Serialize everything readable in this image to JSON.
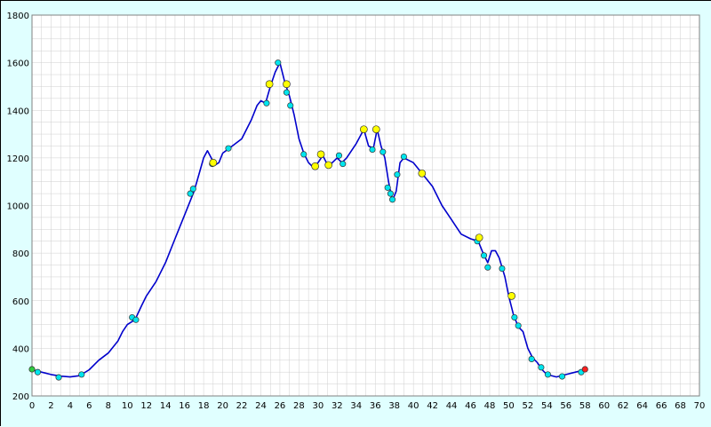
{
  "colors": {
    "page_background": "#e0ffff",
    "plot_background": "#ffffff",
    "grid": "#cfcfcf",
    "line": "#0000cc",
    "marker_cyan": "#00e5ee",
    "marker_yellow": "#ffff00",
    "marker_start": "#2ecc40",
    "marker_end": "#ff2020"
  },
  "chart_data": {
    "type": "line",
    "title": "",
    "xlabel": "",
    "ylabel": "",
    "xlim": [
      0,
      70
    ],
    "ylim": [
      200,
      1800
    ],
    "grid": true,
    "x_ticks": [
      0,
      2,
      4,
      6,
      8,
      10,
      12,
      14,
      16,
      18,
      20,
      22,
      24,
      26,
      28,
      30,
      32,
      34,
      36,
      38,
      40,
      42,
      44,
      46,
      48,
      50,
      52,
      54,
      56,
      58,
      60,
      62,
      64,
      66,
      68,
      70
    ],
    "y_ticks": [
      200,
      400,
      600,
      800,
      1000,
      1200,
      1400,
      1600,
      1800
    ],
    "series": [
      {
        "points": [
          [
            0,
            310
          ],
          [
            1,
            300
          ],
          [
            2,
            290
          ],
          [
            3,
            283
          ],
          [
            4,
            280
          ],
          [
            5,
            285
          ],
          [
            6,
            310
          ],
          [
            7,
            350
          ],
          [
            8,
            380
          ],
          [
            9,
            430
          ],
          [
            9.5,
            470
          ],
          [
            10,
            500
          ],
          [
            10.8,
            520
          ],
          [
            11.5,
            580
          ],
          [
            12,
            620
          ],
          [
            13,
            680
          ],
          [
            14,
            760
          ],
          [
            15,
            860
          ],
          [
            16,
            960
          ],
          [
            17,
            1060
          ],
          [
            17.5,
            1130
          ],
          [
            18,
            1200
          ],
          [
            18.4,
            1230
          ],
          [
            18.8,
            1200
          ],
          [
            19.2,
            1170
          ],
          [
            19.6,
            1180
          ],
          [
            20,
            1220
          ],
          [
            21,
            1250
          ],
          [
            22,
            1280
          ],
          [
            23,
            1360
          ],
          [
            23.6,
            1420
          ],
          [
            24,
            1440
          ],
          [
            24.5,
            1430
          ],
          [
            25,
            1500
          ],
          [
            25.5,
            1560
          ],
          [
            26,
            1600
          ],
          [
            26.5,
            1520
          ],
          [
            27,
            1460
          ],
          [
            27.5,
            1380
          ],
          [
            28,
            1280
          ],
          [
            28.5,
            1220
          ],
          [
            29,
            1180
          ],
          [
            29.5,
            1160
          ],
          [
            30,
            1180
          ],
          [
            30.5,
            1210
          ],
          [
            31,
            1170
          ],
          [
            31.5,
            1180
          ],
          [
            32,
            1200
          ],
          [
            32.5,
            1180
          ],
          [
            33,
            1200
          ],
          [
            34,
            1260
          ],
          [
            34.8,
            1320
          ],
          [
            35.3,
            1250
          ],
          [
            35.8,
            1240
          ],
          [
            36.2,
            1320
          ],
          [
            36.6,
            1250
          ],
          [
            37,
            1200
          ],
          [
            37.4,
            1100
          ],
          [
            37.8,
            1020
          ],
          [
            38.2,
            1060
          ],
          [
            38.6,
            1180
          ],
          [
            39,
            1200
          ],
          [
            40,
            1180
          ],
          [
            41,
            1130
          ],
          [
            42,
            1080
          ],
          [
            43,
            1000
          ],
          [
            44,
            940
          ],
          [
            45,
            880
          ],
          [
            46,
            860
          ],
          [
            46.8,
            850
          ],
          [
            47.3,
            800
          ],
          [
            47.8,
            760
          ],
          [
            48.2,
            810
          ],
          [
            48.6,
            810
          ],
          [
            49,
            780
          ],
          [
            49.6,
            700
          ],
          [
            50,
            620
          ],
          [
            50.5,
            540
          ],
          [
            51,
            490
          ],
          [
            51.5,
            470
          ],
          [
            52,
            400
          ],
          [
            52.5,
            360
          ],
          [
            53,
            340
          ],
          [
            53.5,
            310
          ],
          [
            54,
            290
          ],
          [
            55,
            280
          ],
          [
            56,
            290
          ],
          [
            57,
            300
          ],
          [
            58,
            310
          ]
        ]
      }
    ],
    "markers_cyan": [
      [
        0.6,
        300
      ],
      [
        2.8,
        278
      ],
      [
        5.2,
        290
      ],
      [
        10.5,
        530
      ],
      [
        10.9,
        520
      ],
      [
        16.6,
        1050
      ],
      [
        16.9,
        1070
      ],
      [
        18.9,
        1175
      ],
      [
        20.6,
        1240
      ],
      [
        24.6,
        1430
      ],
      [
        25.8,
        1600
      ],
      [
        26.7,
        1475
      ],
      [
        27.1,
        1420
      ],
      [
        28.5,
        1215
      ],
      [
        32.2,
        1210
      ],
      [
        32.6,
        1175
      ],
      [
        35.7,
        1235
      ],
      [
        36.8,
        1225
      ],
      [
        37.3,
        1075
      ],
      [
        37.6,
        1050
      ],
      [
        37.8,
        1025
      ],
      [
        38.3,
        1130
      ],
      [
        39,
        1205
      ],
      [
        46.7,
        850
      ],
      [
        47.4,
        790
      ],
      [
        47.8,
        740
      ],
      [
        49.3,
        735
      ],
      [
        50.6,
        530
      ],
      [
        51,
        495
      ],
      [
        52.4,
        355
      ],
      [
        53.4,
        320
      ],
      [
        54.1,
        290
      ],
      [
        55.6,
        282
      ],
      [
        57.6,
        300
      ]
    ],
    "markers_yellow": [
      [
        19,
        1180
      ],
      [
        24.9,
        1510
      ],
      [
        26.7,
        1510
      ],
      [
        29.7,
        1165
      ],
      [
        30.3,
        1215
      ],
      [
        31.1,
        1170
      ],
      [
        34.8,
        1320
      ],
      [
        36.1,
        1320
      ],
      [
        40.9,
        1135
      ],
      [
        46.9,
        865
      ],
      [
        50.3,
        620
      ]
    ],
    "marker_start": [
      0,
      312
    ],
    "marker_end": [
      58,
      312
    ]
  }
}
